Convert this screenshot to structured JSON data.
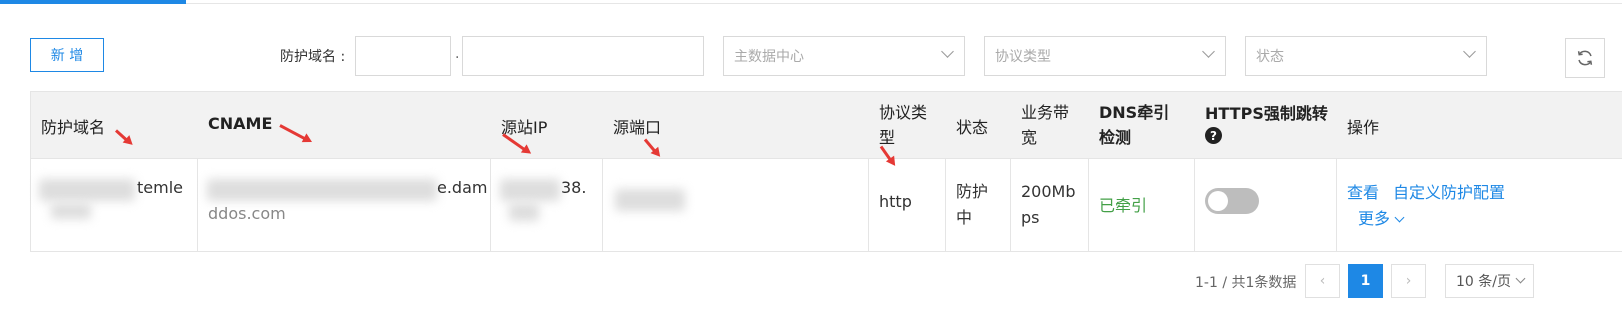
{
  "toolbar": {
    "new_label": "新 增",
    "domain_label": "防护域名 :",
    "dot": ".",
    "datacenter_placeholder": "主数据中心",
    "protocol_placeholder": "协议类型",
    "status_placeholder": "状态"
  },
  "table": {
    "headers": {
      "domain": "防护域名",
      "cname": "CNAME",
      "origin_ip": "源站IP",
      "origin_port": "源端口",
      "protocol": "协议类型",
      "status": "状态",
      "bandwidth": "业务带宽",
      "dns": "DNS牵引检测",
      "https": "HTTPS强制跳转",
      "actions": "操作"
    },
    "row": {
      "domain": "temle",
      "cname_line1": "e.dam",
      "cname_line2": "ddos.com",
      "origin_ip": "38.",
      "protocol": "http",
      "status": "防护中",
      "bandwidth": "200Mbps",
      "dns": "已牵引",
      "https_enabled": false,
      "action_view": "查看",
      "action_custom": "自定义防护配置",
      "action_more": "更多"
    }
  },
  "pagination": {
    "summary": "1-1 / 共1条数据",
    "current_page": "1",
    "page_size": "10 条/页"
  },
  "colors": {
    "primary": "#1e88e5",
    "success": "#43a047",
    "annotation_arrow": "#e53935"
  }
}
